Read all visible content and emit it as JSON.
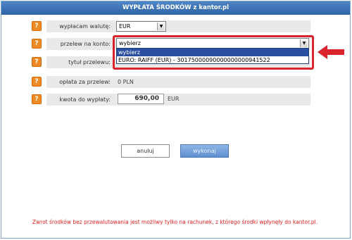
{
  "title": "WYPŁATA ŚRODKÓW z kantor.pl",
  "help_glyph": "?",
  "rows": [
    {
      "label": "wypłacam walutę:",
      "value": "EUR"
    },
    {
      "label": "przelew na konto:",
      "value": "wybierz"
    },
    {
      "label": "tytuł przelewu:"
    },
    {
      "label": "opłata za przelew:",
      "value": "0 PLN"
    },
    {
      "label": "kwota do wypłaty:",
      "value": "690,00",
      "currency": "EUR"
    }
  ],
  "dropdown": {
    "options": [
      "wybierz",
      "EURO: RAIFF (EUR) - 30175000090000000000941522"
    ]
  },
  "buttons": {
    "cancel": "anuluj",
    "submit": "wykonaj"
  },
  "footer": "Zwrot środków bez przewalutowania jest możliwy tylko na rachunek, z którego środki wpłynęły do kantor.pl.",
  "colors": {
    "accent": "#2f63a6",
    "help": "#f08a24",
    "highlight": "#d9232d",
    "footer_text": "#e02020"
  }
}
